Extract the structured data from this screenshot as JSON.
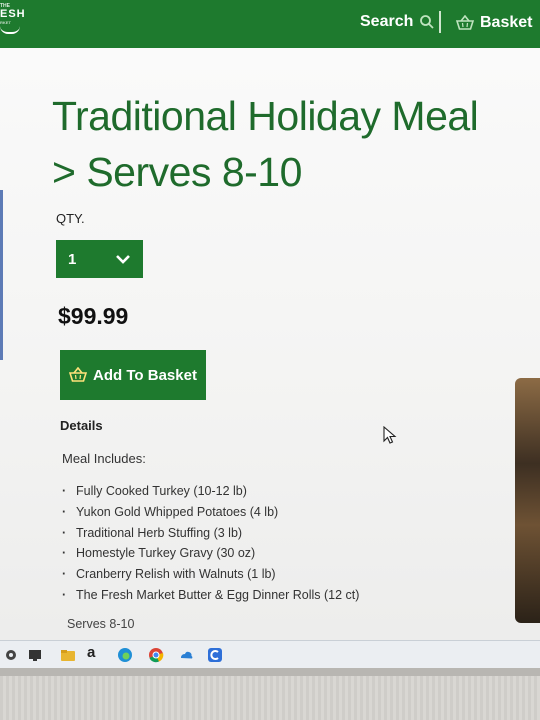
{
  "header": {
    "logo_line1": "THE",
    "logo_line2": "ESH",
    "logo_line3": "RKET",
    "search_label": "Search",
    "basket_label": "Basket"
  },
  "product": {
    "title_line1": "Traditional Holiday Meal",
    "title_line2": "> Serves 8-10",
    "qty_label": "QTY.",
    "qty_value": "1",
    "price": "$99.99",
    "add_button_label": "Add To Basket",
    "details_label": "Details",
    "includes_label": "Meal Includes:",
    "items": [
      "Fully Cooked Turkey (10-12 lb)",
      "Yukon Gold Whipped Potatoes (4 lb)",
      "Traditional Herb Stuffing (3 lb)",
      "Homestyle Turkey Gravy (30 oz)",
      "Cranberry Relish with Walnuts (1 lb)",
      "The Fresh Market Butter & Egg Dinner Rolls (12 ct)"
    ],
    "serves_footer": "Serves 8-10"
  },
  "taskbar": {
    "store_letter": "a",
    "icons": [
      "settings-icon",
      "monitor-icon",
      "file-explorer-icon",
      "amazon-icon",
      "edge-icon",
      "chrome-icon",
      "onedrive-icon",
      "app-icon"
    ]
  },
  "colors": {
    "brand_green": "#1e7a2e",
    "title_green": "#1f6b2c"
  }
}
